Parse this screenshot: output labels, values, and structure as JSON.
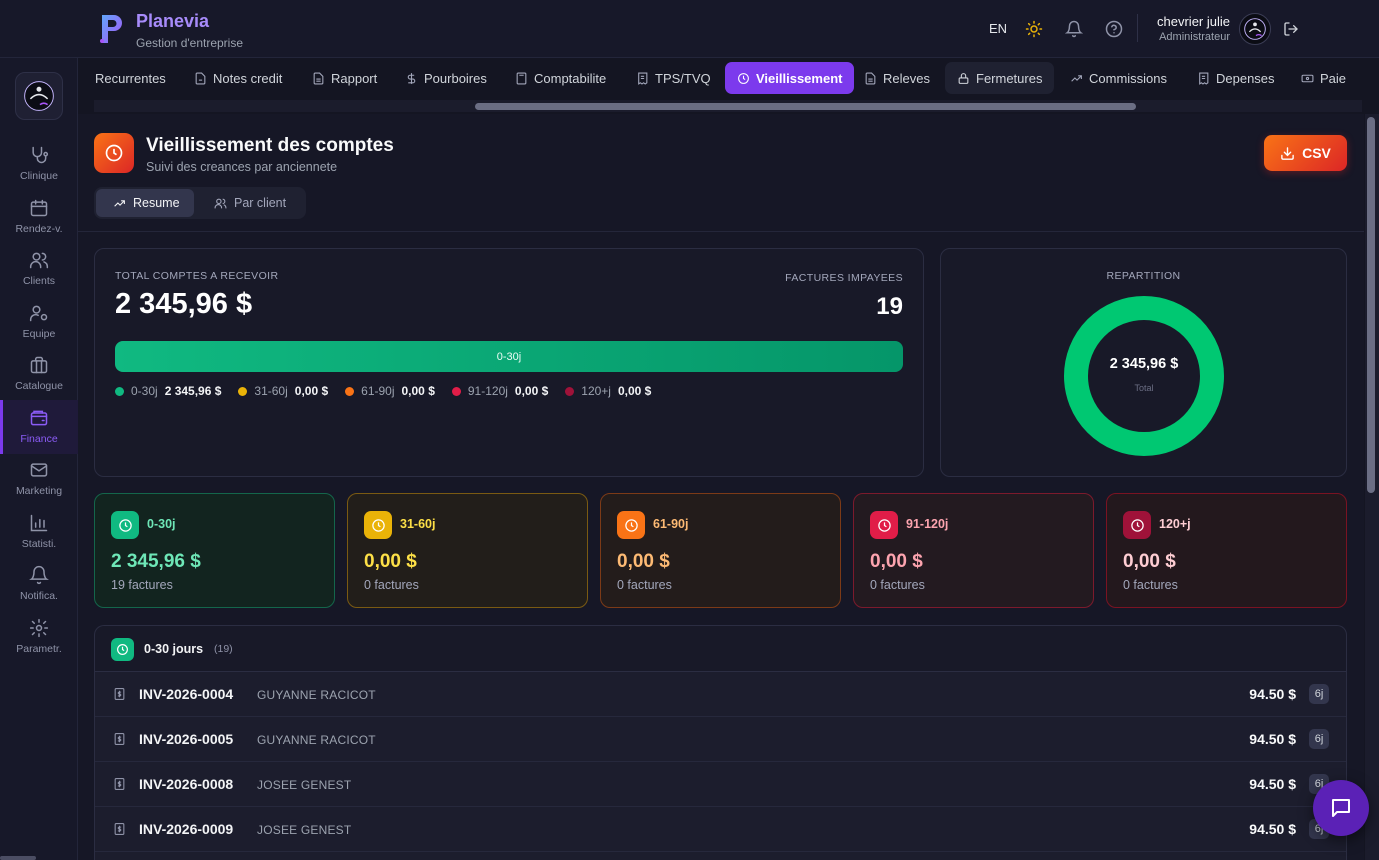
{
  "brand": {
    "name": "Planevia",
    "subtitle": "Gestion d'entreprise"
  },
  "header": {
    "language": "EN",
    "user_name": "chevrier julie",
    "user_role": "Administrateur",
    "icons": [
      "sun-icon",
      "bell-icon",
      "help-icon",
      "logout-icon"
    ]
  },
  "sidebar": {
    "items": [
      {
        "label": "Clinique",
        "icon": "stethoscope-icon"
      },
      {
        "label": "Rendez-v.",
        "icon": "calendar-icon"
      },
      {
        "label": "Clients",
        "icon": "users-icon"
      },
      {
        "label": "Equipe",
        "icon": "team-gear-icon"
      },
      {
        "label": "Catalogue",
        "icon": "briefcase-icon"
      },
      {
        "label": "Finance",
        "icon": "wallet-icon",
        "active": true
      },
      {
        "label": "Marketing",
        "icon": "mail-icon"
      },
      {
        "label": "Statisti.",
        "icon": "bar-chart-icon"
      },
      {
        "label": "Notifica.",
        "icon": "bell-icon"
      },
      {
        "label": "Parametr.",
        "icon": "gear-icon"
      }
    ]
  },
  "tabs": [
    {
      "label": "Recurrentes"
    },
    {
      "label": "Notes credit"
    },
    {
      "label": "Rapport"
    },
    {
      "label": "Pourboires"
    },
    {
      "label": "Comptabilite"
    },
    {
      "label": "TPS/TVQ"
    },
    {
      "label": "Vieillissement",
      "active": true
    },
    {
      "label": "Releves"
    },
    {
      "label": "Fermetures"
    },
    {
      "label": "Commissions"
    },
    {
      "label": "Depenses"
    },
    {
      "label": "Paie"
    }
  ],
  "page": {
    "title": "Vieillissement des comptes",
    "subtitle": "Suivi des creances par anciennete",
    "export_label": "CSV",
    "views": [
      "Resume",
      "Par client"
    ]
  },
  "summary": {
    "total_label": "TOTAL COMPTES A RECEVOIR",
    "total_value": "2 345,96 $",
    "unpaid_label": "FACTURES IMPAYEES",
    "unpaid_value": "19",
    "bar_label": "0-30j",
    "bar_fraction": 1.0,
    "legend": [
      {
        "name": "0-30j",
        "value": "2 345,96 $",
        "color": "#10b981"
      },
      {
        "name": "31-60j",
        "value": "0,00 $",
        "color": "#eab308"
      },
      {
        "name": "61-90j",
        "value": "0,00 $",
        "color": "#f97316"
      },
      {
        "name": "91-120j",
        "value": "0,00 $",
        "color": "#e11d48"
      },
      {
        "name": "120+j",
        "value": "0,00 $",
        "color": "#9f1239"
      }
    ]
  },
  "repartition": {
    "title": "REPARTITION",
    "center_value": "2 345,96 $",
    "center_label": "Total"
  },
  "buckets": [
    {
      "name": "0-30j",
      "amount": "2 345,96 $",
      "count": "19 factures",
      "accent": "#10b981",
      "text": "#6ee7b7"
    },
    {
      "name": "31-60j",
      "amount": "0,00 $",
      "count": "0 factures",
      "accent": "#eab308",
      "text": "#fde047"
    },
    {
      "name": "61-90j",
      "amount": "0,00 $",
      "count": "0 factures",
      "accent": "#f97316",
      "text": "#fdba74"
    },
    {
      "name": "91-120j",
      "amount": "0,00 $",
      "count": "0 factures",
      "accent": "#e11d48",
      "text": "#fda4af"
    },
    {
      "name": "120+j",
      "amount": "0,00 $",
      "count": "0 factures",
      "accent": "#9f1239",
      "text": "#fecdd3"
    }
  ],
  "invoice_group": {
    "title": "0-30 jours",
    "count": "(19)",
    "rows": [
      {
        "invoice": "INV-2026-0004",
        "client": "GUYANNE RACICOT",
        "amount": "94.50 $",
        "age": "6j"
      },
      {
        "invoice": "INV-2026-0005",
        "client": "GUYANNE RACICOT",
        "amount": "94.50 $",
        "age": "6j"
      },
      {
        "invoice": "INV-2026-0008",
        "client": "JOSEE GENEST",
        "amount": "94.50 $",
        "age": "6j"
      },
      {
        "invoice": "INV-2026-0009",
        "client": "JOSEE GENEST",
        "amount": "94.50 $",
        "age": "6j"
      }
    ]
  }
}
